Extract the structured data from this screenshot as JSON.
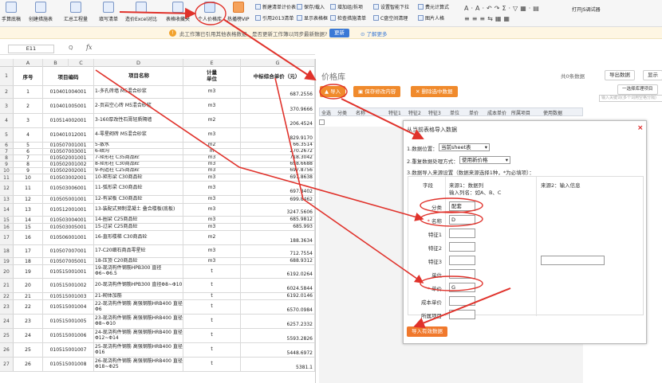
{
  "toolbar": {
    "big_items": [
      "手算底稿",
      "创建措施表",
      "汇总工程量",
      "填写清单",
      "造价Excel对比",
      "表格收藏夹",
      "个人价格库",
      "热播榜VIP"
    ],
    "small_items": [
      "新建清单计价表",
      "保存/载入",
      "增加组/拆项",
      "设置智能下拉",
      "费元计算式",
      "引用2013清单",
      "显示表格框",
      "检查措施清单",
      "C盘空间清理",
      "图片人格"
    ],
    "js_debugger": "打开JS调试器"
  },
  "notice": {
    "text": "此工作簿已引用其他表格数据，是否更新工作簿以同步最新数据?",
    "update_button": "更新",
    "learn_more": "了解更多"
  },
  "formula_bar": {
    "cell": "E11",
    "zoom_icon": "Q",
    "fx": "fx"
  },
  "columns": [
    "A",
    "B",
    "C",
    "D",
    "E",
    "G"
  ],
  "sheet_header": {
    "row": "1",
    "a": "序号",
    "b": "项目编码",
    "d": "项目名称",
    "e_line1": "计量",
    "e_line2": "单位",
    "g": "中标综合单价（元）"
  },
  "rows": [
    {
      "r": "2",
      "a": "1",
      "b": "010401004001",
      "d": "1-多孔砖墙 M5混合砂浆",
      "e": "m3",
      "g": "687.2556"
    },
    {
      "r": "3",
      "a": "2",
      "b": "010401005001",
      "d": "2-页岩空心砖 M5混合砂浆",
      "e": "m3",
      "g": "370.9666"
    },
    {
      "r": "4",
      "a": "3",
      "b": "010514002001",
      "d": "3-160厚改性石膏轻质隔墙",
      "e": "m2",
      "g": "206.4524"
    },
    {
      "r": "5",
      "a": "4",
      "b": "010401012001",
      "d": "4-零星砌砖 M5混合砂浆",
      "e": "m3",
      "g": "829.9170"
    },
    {
      "r": "6",
      "a": "5",
      "b": "010507001001",
      "d": "5-散水",
      "e": "m2",
      "g": "66.3514"
    },
    {
      "r": "7",
      "a": "6",
      "b": "010507003001",
      "d": "6-暗沟",
      "e": "m",
      "g": "270.2672"
    },
    {
      "r": "8",
      "a": "7",
      "b": "010502001001",
      "d": "7-矩形柱 C35商品砼",
      "e": "m3",
      "g": "718.3042"
    },
    {
      "r": "9",
      "a": "8",
      "b": "010502001002",
      "d": "8-矩形柱 C30商品砼",
      "e": "m3",
      "g": "698.6688"
    },
    {
      "r": "10",
      "a": "9",
      "b": "010502002001",
      "d": "9-构造柱 C25商品砼",
      "e": "m3",
      "g": "697.8756"
    },
    {
      "r": "11",
      "a": "10",
      "b": "010503002001",
      "d": "10-矩形梁 C30商品砼",
      "e": "m3",
      "g": "697.8638"
    },
    {
      "r": "12",
      "a": "11",
      "b": "010503006001",
      "d": "11-弧形梁 C30商品砼",
      "e": "m3",
      "g": "697.8402"
    },
    {
      "r": "13",
      "a": "12",
      "b": "010505001001",
      "d": "12-有梁板 C30商品砼",
      "e": "m3",
      "g": "699.8462"
    },
    {
      "r": "14",
      "a": "13",
      "b": "010512001001",
      "d": "13-装配式预制混凝土 叠合楼板(底板)",
      "e": "m3",
      "g": "3247.5606"
    },
    {
      "r": "15",
      "a": "14",
      "b": "010503004001",
      "d": "14-圈梁 C25商品砼",
      "e": "m3",
      "g": "685.9812"
    },
    {
      "r": "16",
      "a": "15",
      "b": "010503005001",
      "d": "15-过梁 C25商品砼",
      "e": "m3",
      "g": "685.993"
    },
    {
      "r": "17",
      "a": "16",
      "b": "010506001001",
      "d": "16-直形楼梯 C30商品砼",
      "e": "m2",
      "g": "188.3634"
    },
    {
      "r": "18",
      "a": "17",
      "b": "010507007001",
      "d": "17-C20细石商品零星砼",
      "e": "m3",
      "g": "712.7554"
    },
    {
      "r": "19",
      "a": "18",
      "b": "010507005001",
      "d": "18-压顶 C20商品砼",
      "e": "m3",
      "g": "688.9312"
    },
    {
      "r": "20",
      "a": "19",
      "b": "010515001001",
      "d": "19-现浇构件钢筋HPB300 直径Φ6~Φ6.5",
      "e": "t",
      "g": "6192.0264"
    },
    {
      "r": "21",
      "a": "20",
      "b": "010515001002",
      "d": "20-现浇构件钢筋HPB300 直径Φ8~Φ10",
      "e": "t",
      "g": "6024.5844"
    },
    {
      "r": "22",
      "a": "21",
      "b": "010515001003",
      "d": "21-砌体加筋",
      "e": "t",
      "g": "6192.0146"
    },
    {
      "r": "23",
      "a": "22",
      "b": "010515001004",
      "d": "22-现浇构件钢筋 高强钢筋HRB400 直径Φ6",
      "e": "t",
      "g": "6570.0984"
    },
    {
      "r": "24",
      "a": "23",
      "b": "010515001005",
      "d": "23-现浇构件钢筋 高强钢筋HRB400 直径Φ8~Φ10",
      "e": "t",
      "g": "6257.2332"
    },
    {
      "r": "25",
      "a": "24",
      "b": "010515001006",
      "d": "24-现浇构件钢筋 高强钢筋HRB400 直径Φ12~Φ14",
      "e": "t",
      "g": "5593.2826"
    },
    {
      "r": "26",
      "a": "25",
      "b": "010515001007",
      "d": "25-现浇构件钢筋 高强钢筋HRB400 直径Φ16",
      "e": "t",
      "g": "5448.6972"
    },
    {
      "r": "27",
      "a": "26",
      "b": "010515001008",
      "d": "26-现浇构件钢筋 高强钢筋HRB400 直径Φ18~Φ25",
      "e": "t",
      "g": "5381.1"
    }
  ],
  "panel": {
    "title": "价格库",
    "count": "共0条数据",
    "export_btn": "导出数据",
    "view_btn": "显示",
    "import_btn": "导入",
    "save_btn": "保存修改内容",
    "delete_btn": "删除选中数据",
    "select_lib": "一选择库理项目",
    "search_placeholder": "输入关键词(多个词用空格分隔)",
    "headers": [
      "全选",
      "分类",
      "名称",
      "特征1",
      "特征2",
      "特征3",
      "单位",
      "单价",
      "成本单价",
      "所属项目",
      "使用数据"
    ]
  },
  "dialog": {
    "title": "从当前表格导入数据",
    "step1_label": "1.数据位置：",
    "step1_value": "当前sheet表",
    "step2_label": "2.重复数据处理方式：",
    "step2_value": "使用新价格",
    "step3_label": "3.数据导入来源设置（数据来源选择1种，*为必填项）：",
    "col_field": "字段",
    "col_src1_line1": "来源1：数据列",
    "col_src1_line2": "输入列名：如A、B、C",
    "col_src2": "来源2：输入信息",
    "fields": [
      {
        "label": "分类",
        "value": "配套",
        "req": false
      },
      {
        "label": "名称",
        "value": "D",
        "req": true
      },
      {
        "label": "特征1",
        "value": "",
        "req": false
      },
      {
        "label": "特征2",
        "value": "",
        "req": false
      },
      {
        "label": "特征3",
        "value": "",
        "req": false
      },
      {
        "label": "单位",
        "value": "",
        "req": false
      },
      {
        "label": "单价",
        "value": "G",
        "req": true
      },
      {
        "label": "成本单价",
        "value": "",
        "req": false
      },
      {
        "label": "所属项目",
        "value": "",
        "req": false
      }
    ],
    "import_valid_btn": "导入有效数据",
    "close": "×"
  },
  "colors": {
    "accent": "#f08a2c",
    "annotation": "#e0322b",
    "notice_bg": "#fef6e3",
    "blue": "#3b79d6"
  }
}
